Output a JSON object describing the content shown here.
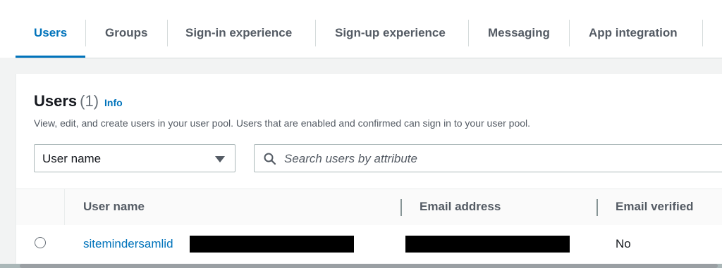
{
  "tabs": [
    {
      "label": "Users",
      "active": true
    },
    {
      "label": "Groups",
      "active": false
    },
    {
      "label": "Sign-in experience",
      "active": false
    },
    {
      "label": "Sign-up experience",
      "active": false
    },
    {
      "label": "Messaging",
      "active": false
    },
    {
      "label": "App integration",
      "active": false
    }
  ],
  "panel": {
    "title": "Users",
    "count": "(1)",
    "info_label": "Info",
    "description": "View, edit, and create users in your user pool. Users that are enabled and confirmed can sign in to your user pool."
  },
  "filter": {
    "selected": "User name",
    "search_placeholder": "Search users by attribute"
  },
  "table": {
    "columns": [
      "User name",
      "Email address",
      "Email verified"
    ],
    "rows": [
      {
        "username": "sitemindersamlid",
        "email": "",
        "email_verified": "No"
      }
    ]
  },
  "colors": {
    "accent": "#0073bb",
    "text": "#16191f",
    "muted": "#545b64",
    "background": "#f2f3f3"
  },
  "icons": {
    "search": "search-icon",
    "caret": "caret-down-icon",
    "radio": "radio-icon"
  }
}
